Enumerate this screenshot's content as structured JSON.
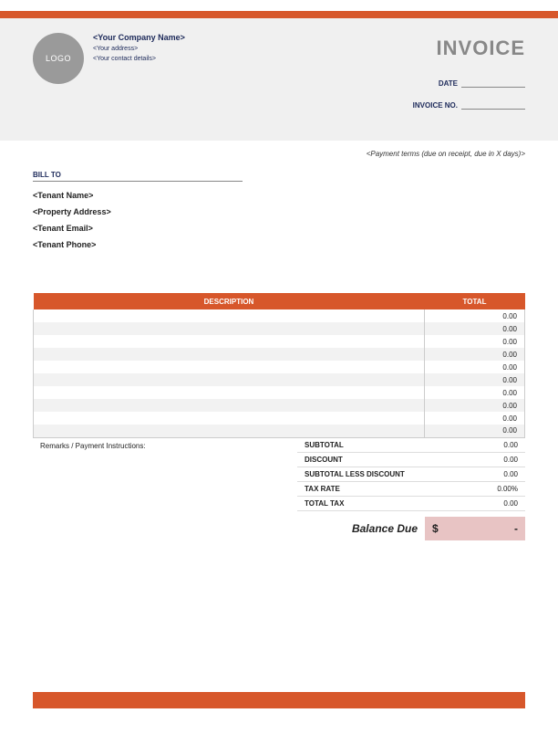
{
  "logo_text": "LOGO",
  "company": {
    "name": "<Your Company Name>",
    "address": "<Your address>",
    "contact": "<Your contact details>"
  },
  "invoice_title": "INVOICE",
  "meta": {
    "date_label": "DATE",
    "date_value": "",
    "invoice_no_label": "INVOICE NO.",
    "invoice_no_value": ""
  },
  "payment_terms": "<Payment terms (due on receipt, due in X days)>",
  "bill_to_label": "BILL TO",
  "bill_to": {
    "tenant_name": "<Tenant Name>",
    "property_address": "<Property Address>",
    "tenant_email": "<Tenant Email>",
    "tenant_phone": "<Tenant Phone>"
  },
  "table_headers": {
    "description": "DESCRIPTION",
    "total": "TOTAL"
  },
  "items": [
    {
      "description": "",
      "total": "0.00"
    },
    {
      "description": "",
      "total": "0.00"
    },
    {
      "description": "",
      "total": "0.00"
    },
    {
      "description": "",
      "total": "0.00"
    },
    {
      "description": "",
      "total": "0.00"
    },
    {
      "description": "",
      "total": "0.00"
    },
    {
      "description": "",
      "total": "0.00"
    },
    {
      "description": "",
      "total": "0.00"
    },
    {
      "description": "",
      "total": "0.00"
    },
    {
      "description": "",
      "total": "0.00"
    }
  ],
  "remarks_label": "Remarks / Payment Instructions:",
  "totals": {
    "subtotal_label": "SUBTOTAL",
    "subtotal_value": "0.00",
    "discount_label": "DISCOUNT",
    "discount_value": "0.00",
    "less_discount_label": "SUBTOTAL LESS DISCOUNT",
    "less_discount_value": "0.00",
    "tax_rate_label": "TAX RATE",
    "tax_rate_value": "0.00%",
    "total_tax_label": "TOTAL TAX",
    "total_tax_value": "0.00"
  },
  "balance": {
    "label": "Balance Due",
    "currency": "$",
    "value": "-"
  }
}
